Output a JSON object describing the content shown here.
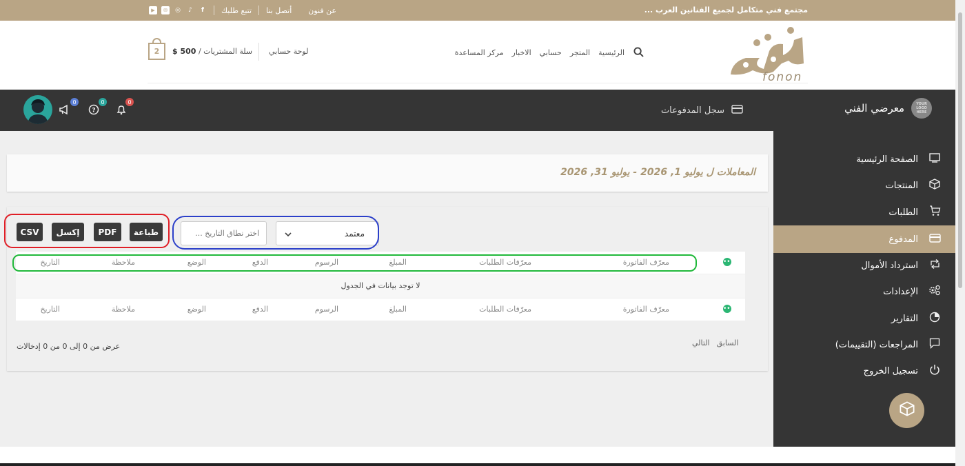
{
  "topbar": {
    "tagline": "مجتمع فني متكامل لجميع الفنانين العرب ...",
    "links": [
      "عن فنون",
      "أتصل بنا",
      "تتبع طلبك"
    ]
  },
  "header": {
    "logo_text": "fonon",
    "nav": [
      "الرئيسية",
      "المتجر",
      "حسابي",
      "الاخبار",
      "مركز المساعدة"
    ],
    "account_link": "لوحة حسابي",
    "cart_label": "سلة المشتريات /",
    "cart_total": "500 $",
    "cart_count": "2"
  },
  "dashboard": {
    "page_title": "سجل المدفوعات",
    "gallery_title": "معرضي الفني",
    "gallery_logo_text": "YOUR LOGO HERE",
    "announcements_count": "0",
    "help_count": "0",
    "notifications_count": "0"
  },
  "sidebar": {
    "items": [
      {
        "label": "الصفحة الرئيسية",
        "icon": "monitor-icon"
      },
      {
        "label": "المنتجات",
        "icon": "box-icon"
      },
      {
        "label": "الطلبات",
        "icon": "cart-icon"
      },
      {
        "label": "المدفوع",
        "icon": "credit-card-icon",
        "active": true
      },
      {
        "label": "استرداد الأموال",
        "icon": "refund-icon"
      },
      {
        "label": "الإعدادات",
        "icon": "settings-icon"
      },
      {
        "label": "التقارير",
        "icon": "pie-chart-icon"
      },
      {
        "label": "المراجعات (التقييمات)",
        "icon": "comment-icon"
      },
      {
        "label": "تسجيل الخروج",
        "icon": "power-icon"
      }
    ]
  },
  "range": {
    "text": "المعاملات ل يوليو 1, 2026 - يوليو 31, 2026"
  },
  "toolbar": {
    "csv": "CSV",
    "excel": "إكسل",
    "pdf": "PDF",
    "print": "طباعة",
    "date_placeholder": "اختر نطاق التاريخ ...",
    "status_selected": "معتمد"
  },
  "table": {
    "columns": [
      "معرّف الفاتورة",
      "معرّفات الطلبات",
      "المبلغ",
      "الرسوم",
      "الدفع",
      "الوضع",
      "ملاحظة",
      "التاريخ"
    ],
    "empty_message": "لا توجد بيانات في الجدول",
    "info": "عرض من 0 إلى 0 من 0 إدخالات",
    "prev": "السابق",
    "next": "التالي"
  },
  "annotations": {
    "export_ring_color": "#e01e26",
    "filter_ring_color": "#2b3fc9",
    "header_ring_color": "#20b83a"
  },
  "colors": {
    "brand": "#b9a585",
    "dark": "#353535"
  }
}
